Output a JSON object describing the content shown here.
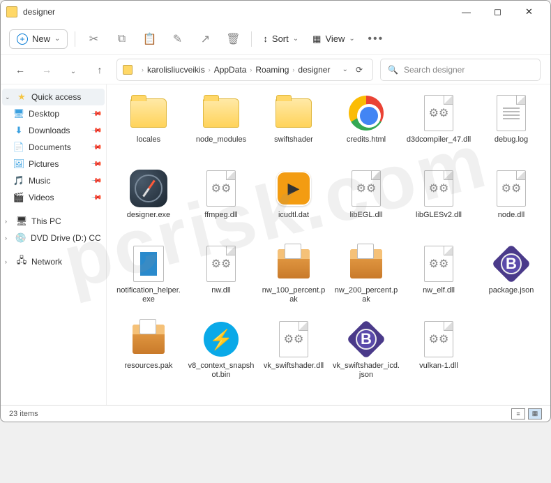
{
  "title": "designer",
  "toolbar": {
    "new": "New",
    "sort": "Sort",
    "view": "View"
  },
  "breadcrumb": [
    "karolisliucveikis",
    "AppData",
    "Roaming",
    "designer"
  ],
  "search_placeholder": "Search designer",
  "sidebar": {
    "quick": "Quick access",
    "items": [
      "Desktop",
      "Downloads",
      "Documents",
      "Pictures",
      "Music",
      "Videos"
    ],
    "thispc": "This PC",
    "dvd": "DVD Drive (D:) CCCC",
    "network": "Network"
  },
  "files": [
    {
      "name": "locales",
      "kind": "folder"
    },
    {
      "name": "node_modules",
      "kind": "folder"
    },
    {
      "name": "swiftshader",
      "kind": "folder"
    },
    {
      "name": "credits.html",
      "kind": "chrome"
    },
    {
      "name": "d3dcompiler_47.dll",
      "kind": "dll"
    },
    {
      "name": "debug.log",
      "kind": "text"
    },
    {
      "name": "designer.exe",
      "kind": "compass"
    },
    {
      "name": "ffmpeg.dll",
      "kind": "dll"
    },
    {
      "name": "icudtl.dat",
      "kind": "play"
    },
    {
      "name": "libEGL.dll",
      "kind": "dll"
    },
    {
      "name": "libGLESv2.dll",
      "kind": "dll"
    },
    {
      "name": "node.dll",
      "kind": "dll"
    },
    {
      "name": "notification_helper.exe",
      "kind": "notif"
    },
    {
      "name": "nw.dll",
      "kind": "dll"
    },
    {
      "name": "nw_100_percent.pak",
      "kind": "box"
    },
    {
      "name": "nw_200_percent.pak",
      "kind": "box"
    },
    {
      "name": "nw_elf.dll",
      "kind": "dll"
    },
    {
      "name": "package.json",
      "kind": "bicon"
    },
    {
      "name": "resources.pak",
      "kind": "box"
    },
    {
      "name": "v8_context_snapshot.bin",
      "kind": "bolt"
    },
    {
      "name": "vk_swiftshader.dll",
      "kind": "dll"
    },
    {
      "name": "vk_swiftshader_icd.json",
      "kind": "bicon"
    },
    {
      "name": "vulkan-1.dll",
      "kind": "dll"
    }
  ],
  "status": "23 items",
  "sidebar_icon_colors": {
    "Desktop": "#3aa0e0",
    "Downloads": "#3aa0e0",
    "Documents": "#3aa0e0",
    "Pictures": "#3aa0e0",
    "Music": "#e05a9a",
    "Videos": "#7a4ae0"
  },
  "watermark": "pcrisk.com"
}
